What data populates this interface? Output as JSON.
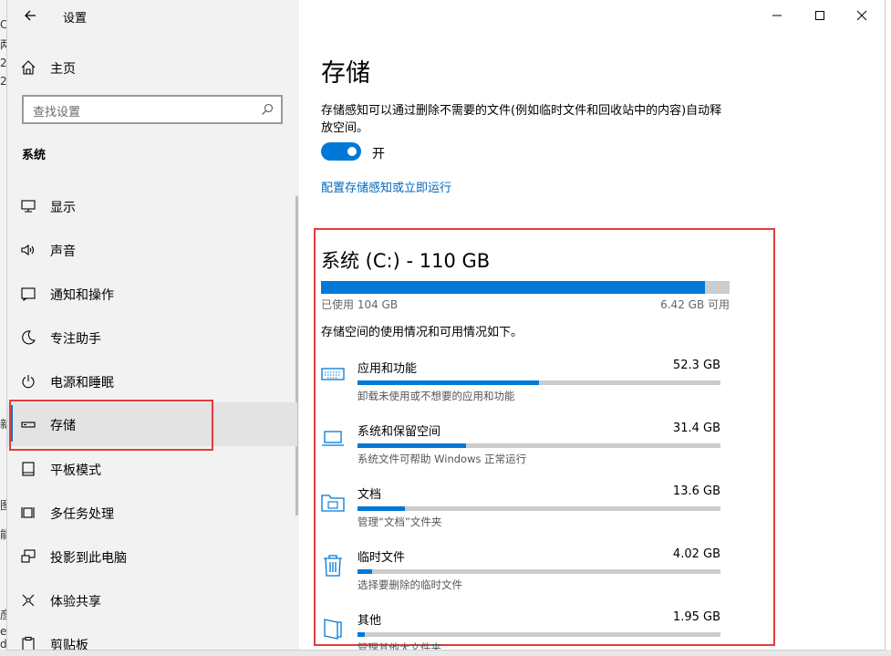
{
  "window": {
    "title": "设置"
  },
  "sidebar": {
    "home_label": "主页",
    "search_placeholder": "查找设置",
    "section_title": "系统",
    "items": [
      {
        "label": "显示",
        "icon": "monitor-icon"
      },
      {
        "label": "声音",
        "icon": "speaker-icon"
      },
      {
        "label": "通知和操作",
        "icon": "notification-icon"
      },
      {
        "label": "专注助手",
        "icon": "moon-icon"
      },
      {
        "label": "电源和睡眠",
        "icon": "power-icon"
      },
      {
        "label": "存储",
        "icon": "storage-icon",
        "selected": true
      },
      {
        "label": "平板模式",
        "icon": "tablet-icon"
      },
      {
        "label": "多任务处理",
        "icon": "multitask-icon"
      },
      {
        "label": "投影到此电脑",
        "icon": "project-icon"
      },
      {
        "label": "体验共享",
        "icon": "share-icon"
      },
      {
        "label": "剪贴板",
        "icon": "clipboard-icon"
      }
    ]
  },
  "background_chars": [
    "C",
    "两",
    "2",
    "2",
    "新",
    "图",
    "能",
    "彦",
    "e",
    "d"
  ],
  "main": {
    "page_title": "存储",
    "description": "存储感知可以通过删除不需要的文件(例如临时文件和回收站中的内容)自动释放空间。",
    "toggle": {
      "state": "开",
      "on": true
    },
    "link_text": "配置存储感知或立即运行",
    "drive": {
      "title": "系统 (C:) - 110 GB",
      "used_label": "已使用 104 GB",
      "free_label": "6.42 GB 可用",
      "used_fraction": 0.94,
      "desc": "存储空间的使用情况和可用情况如下。"
    },
    "categories": [
      {
        "name": "应用和功能",
        "size": "52.3 GB",
        "desc": "卸载未使用或不想要的应用和功能",
        "icon": "keyboard-icon",
        "fraction": 0.5
      },
      {
        "name": "系统和保留空间",
        "size": "31.4 GB",
        "desc": "系统文件可帮助 Windows 正常运行",
        "icon": "laptop-icon",
        "fraction": 0.3
      },
      {
        "name": "文档",
        "size": "13.6 GB",
        "desc": "管理“文档”文件夹",
        "icon": "folder-icon",
        "fraction": 0.13
      },
      {
        "name": "临时文件",
        "size": "4.02 GB",
        "desc": "选择要删除的临时文件",
        "icon": "trash-icon",
        "fraction": 0.04
      },
      {
        "name": "其他",
        "size": "1.95 GB",
        "desc": "管理其他大文件夹",
        "icon": "other-icon",
        "fraction": 0.02
      }
    ]
  },
  "colors": {
    "accent": "#0078d7",
    "link": "#0067c0",
    "highlight_box": "#e33b3b"
  }
}
